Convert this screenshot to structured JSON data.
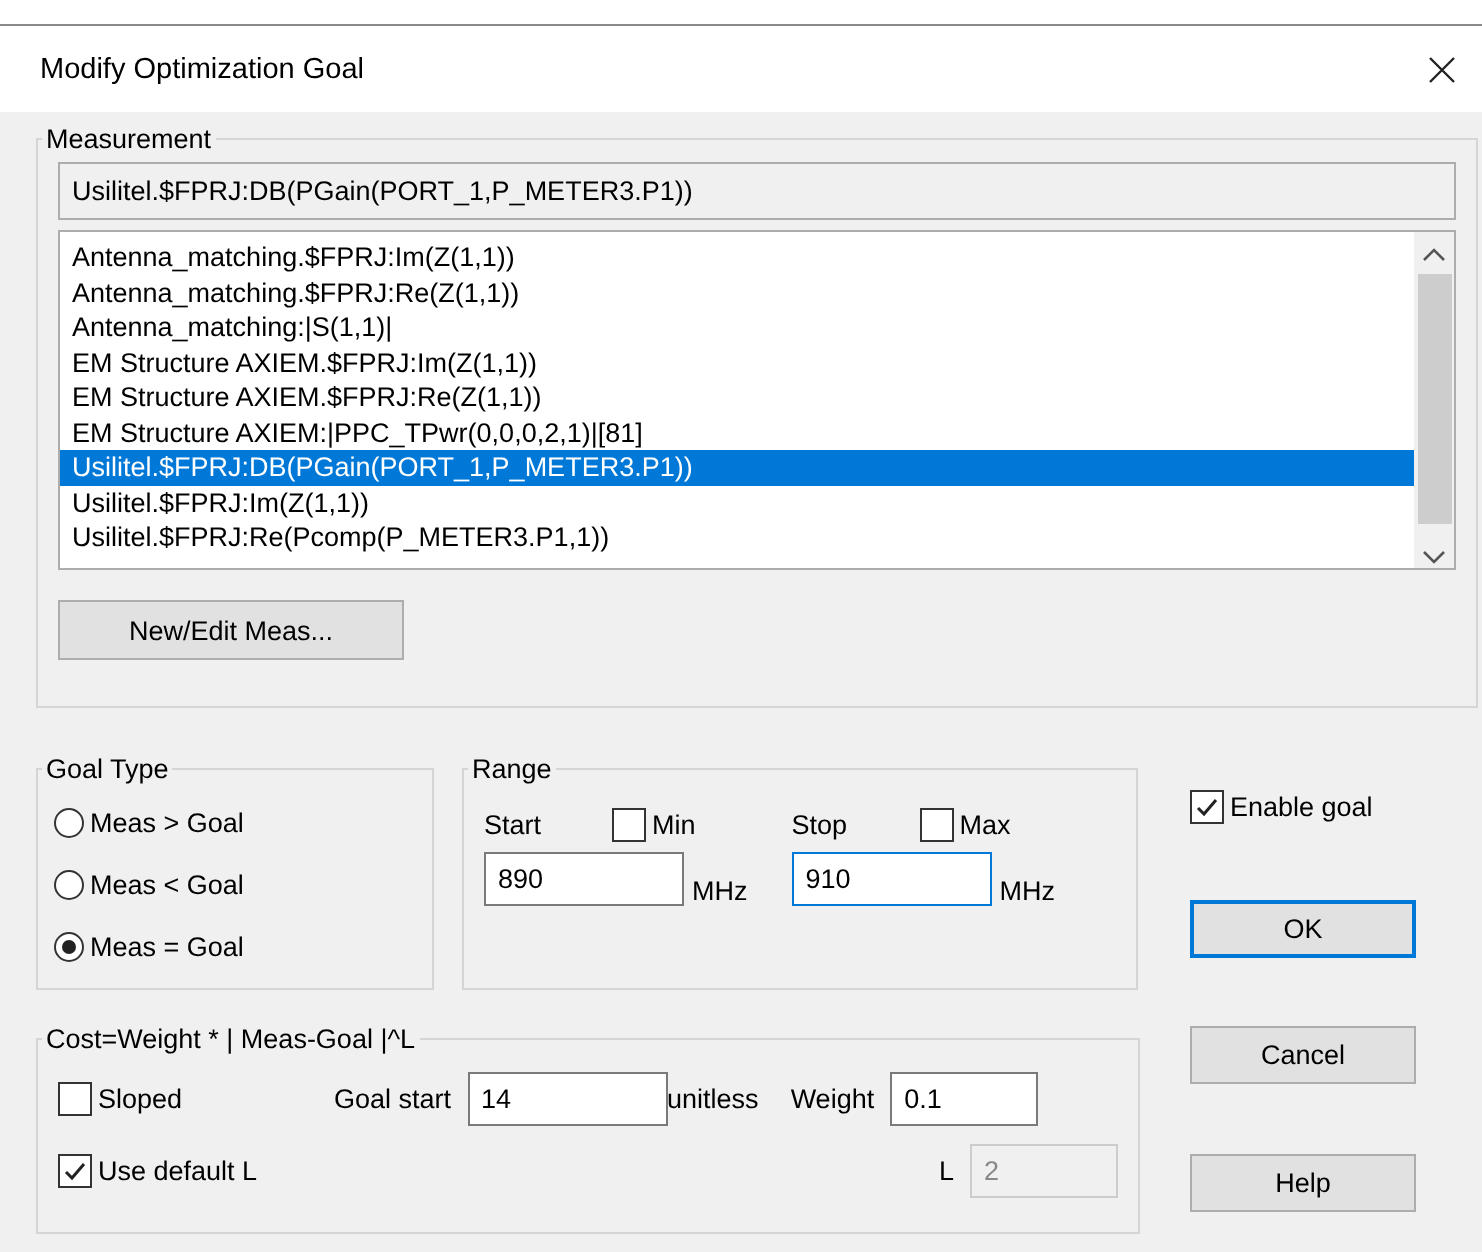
{
  "window": {
    "title": "Modify Optimization Goal"
  },
  "measurement": {
    "label": "Measurement",
    "current": "Usilitel.$FPRJ:DB(PGain(PORT_1,P_METER3.P1))",
    "items": [
      {
        "text": "Antenna_matching.$FPRJ:Im(Z(1,1))",
        "selected": false
      },
      {
        "text": "Antenna_matching.$FPRJ:Re(Z(1,1))",
        "selected": false
      },
      {
        "text": "Antenna_matching:|S(1,1)|",
        "selected": false
      },
      {
        "text": "EM Structure AXIEM.$FPRJ:Im(Z(1,1))",
        "selected": false
      },
      {
        "text": "EM Structure AXIEM.$FPRJ:Re(Z(1,1))",
        "selected": false
      },
      {
        "text": "EM Structure AXIEM:|PPC_TPwr(0,0,0,2,1)|[81]",
        "selected": false
      },
      {
        "text": "Usilitel.$FPRJ:DB(PGain(PORT_1,P_METER3.P1))",
        "selected": true
      },
      {
        "text": "Usilitel.$FPRJ:Im(Z(1,1))",
        "selected": false
      },
      {
        "text": "Usilitel.$FPRJ:Re(Pcomp(P_METER3.P1,1))",
        "selected": false
      }
    ],
    "button": "New/Edit Meas..."
  },
  "goal_type": {
    "label": "Goal Type",
    "options": [
      {
        "label": "Meas > Goal",
        "selected": false
      },
      {
        "label": "Meas < Goal",
        "selected": false
      },
      {
        "label": "Meas = Goal",
        "selected": true
      }
    ]
  },
  "range": {
    "label": "Range",
    "start": {
      "label": "Start",
      "bound_label": "Min",
      "bound_checked": false,
      "value": "890",
      "unit": "MHz",
      "focused": false
    },
    "stop": {
      "label": "Stop",
      "bound_label": "Max",
      "bound_checked": false,
      "value": "910",
      "unit": "MHz",
      "focused": true
    }
  },
  "enable_goal": {
    "label": "Enable goal",
    "checked": true
  },
  "cost": {
    "label": "Cost=Weight * | Meas-Goal |^L",
    "sloped": {
      "label": "Sloped",
      "checked": false
    },
    "goal_start": {
      "label": "Goal start",
      "value": "14",
      "unit": "unitless"
    },
    "weight": {
      "label": "Weight",
      "value": "0.1"
    },
    "use_default_l": {
      "label": "Use default L",
      "checked": true
    },
    "l": {
      "label": "L",
      "value": "2",
      "disabled": true
    }
  },
  "buttons": [
    {
      "label": "OK",
      "default": true
    },
    {
      "label": "Cancel",
      "default": false
    },
    {
      "label": "Help",
      "default": false
    }
  ]
}
